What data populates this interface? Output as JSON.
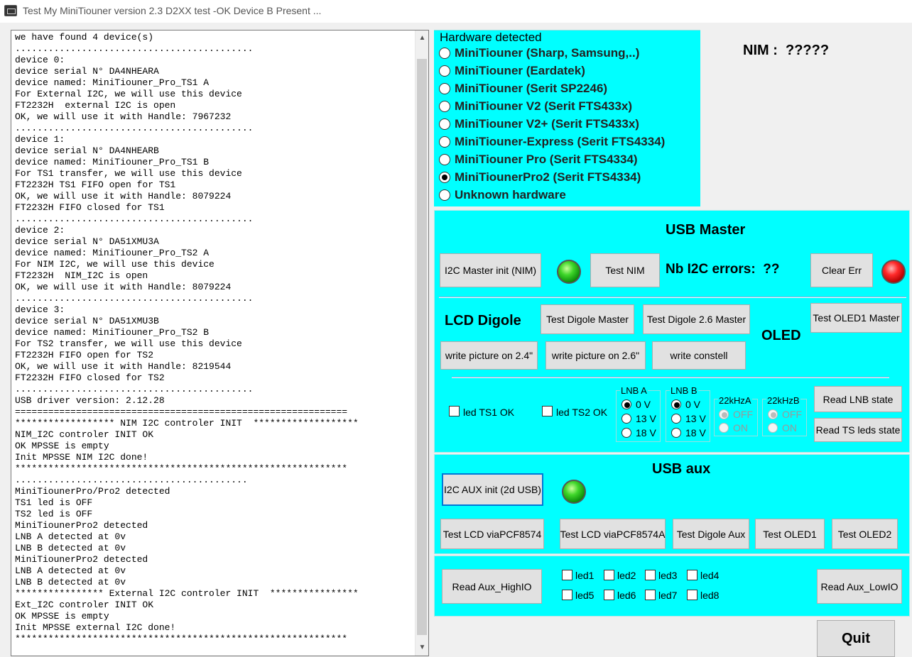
{
  "window": {
    "title": "Test My MiniTiouner version 2.3 D2XX test -OK Device B Present ..."
  },
  "log": {
    "lines": [
      "we have found 4 device(s)",
      "...........................................",
      "device 0:",
      "device serial N° DA4NHEARA",
      "device named: MiniTiouner_Pro_TS1 A",
      "For External I2C, we will use this device",
      "FT2232H  external I2C is open",
      "OK, we will use it with Handle: 7967232",
      "...........................................",
      "device 1:",
      "device serial N° DA4NHEARB",
      "device named: MiniTiouner_Pro_TS1 B",
      "For TS1 transfer, we will use this device",
      "FT2232H TS1 FIFO open for TS1",
      "OK, we will use it with Handle: 8079224",
      "FT2232H FIFO closed for TS1",
      "...........................................",
      "device 2:",
      "device serial N° DA51XMU3A",
      "device named: MiniTiouner_Pro_TS2 A",
      "For NIM I2C, we will use this device",
      "FT2232H  NIM_I2C is open",
      "OK, we will use it with Handle: 8079224",
      "...........................................",
      "device 3:",
      "device serial N° DA51XMU3B",
      "device named: MiniTiouner_Pro_TS2 B",
      "For TS2 transfer, we will use this device",
      "FT2232H FIFO open for TS2",
      "OK, we will use it with Handle: 8219544",
      "FT2232H FIFO closed for TS2",
      "...........................................",
      "USB driver version: 2.12.28",
      "============================================================",
      "****************** NIM I2C controler INIT  *******************",
      "NIM_I2C controler INIT OK",
      "OK MPSSE is empty",
      "Init MPSSE NIM I2C done!",
      "************************************************************",
      "..........................................",
      "MiniTiounerPro/Pro2 detected",
      "TS1 led is OFF",
      "TS2 led is OFF",
      "MiniTiounerPro2 detected",
      "LNB A detected at 0v",
      "LNB B detected at 0v",
      "MiniTiounerPro2 detected",
      "LNB A detected at 0v",
      "LNB B detected at 0v",
      "**************** External I2C controler INIT  ****************",
      "Ext_I2C controler INIT OK",
      "OK MPSSE is empty",
      "Init MPSSE external I2C done!",
      "************************************************************"
    ],
    "scroll_up_icon": "▲",
    "scroll_down_icon": "▼"
  },
  "hardware": {
    "title": "Hardware detected",
    "options": [
      {
        "label": "MiniTiouner (Sharp, Samsung,..)",
        "selected": false
      },
      {
        "label": "MiniTiouner (Eardatek)",
        "selected": false
      },
      {
        "label": "MiniTiouner (Serit SP2246)",
        "selected": false
      },
      {
        "label": "MiniTiouner V2 (Serit FTS433x)",
        "selected": false
      },
      {
        "label": "MiniTiouner V2+ (Serit FTS433x)",
        "selected": false
      },
      {
        "label": "MiniTiouner-Express (Serit FTS4334)",
        "selected": false
      },
      {
        "label": "MiniTiouner Pro  (Serit FTS4334)",
        "selected": false
      },
      {
        "label": "MiniTiounerPro2 (Serit FTS4334)",
        "selected": true
      },
      {
        "label": "Unknown hardware",
        "selected": false
      }
    ]
  },
  "nim_label": "NIM :  ?????",
  "usb_master": {
    "title": "USB Master",
    "i2c_master_init": "I2C Master init (NIM)",
    "test_nim": "Test NIM",
    "nb_errors_label": "Nb I2C errors:  ??",
    "clear_err": "Clear Err",
    "led_master_color": "#3fd62a",
    "led_error_color": "#ff2a2a",
    "lcd_title": "LCD Digole",
    "oled_title": "OLED",
    "test_digole_master": "Test Digole Master",
    "test_digole_26_master": "Test Digole 2.6 Master",
    "test_oled1_master": "Test OLED1 Master",
    "write_picture_24": "write picture on 2.4\"",
    "write_picture_26": "write picture on 2.6\"",
    "write_constell": "write constell",
    "led_ts1": "led TS1 OK",
    "led_ts2": "led TS2 OK",
    "lnb_a": {
      "title": "LNB A",
      "options": [
        "0 V",
        "13 V",
        "18 V"
      ],
      "selected": 0
    },
    "lnb_b": {
      "title": "LNB B",
      "options": [
        "0 V",
        "13 V",
        "18 V"
      ],
      "selected": 0
    },
    "khz_a": {
      "title": "22kHzA",
      "options": [
        "OFF",
        "ON"
      ],
      "selected": 0
    },
    "khz_b": {
      "title": "22kHzB",
      "options": [
        "OFF",
        "ON"
      ],
      "selected": 0
    },
    "read_lnb_state": "Read LNB state",
    "read_ts_leds_state": "Read TS leds state"
  },
  "usb_aux": {
    "title": "USB aux",
    "i2c_aux_init": "I2C AUX init (2d USB)",
    "led_aux_color": "#3fd62a",
    "test_lcd_pcf8574": "Test LCD viaPCF8574",
    "test_lcd_pcf8574a": "Test LCD viaPCF8574A",
    "test_digole_aux": "Test Digole Aux",
    "test_oled1": "Test OLED1",
    "test_oled2": "Test OLED2"
  },
  "aux_io": {
    "read_high": "Read Aux_HighIO",
    "read_low": "Read Aux_LowIO",
    "leds": [
      "led1",
      "led2",
      "led3",
      "led4",
      "led5",
      "led6",
      "led7",
      "led8"
    ]
  },
  "quit": "Quit"
}
